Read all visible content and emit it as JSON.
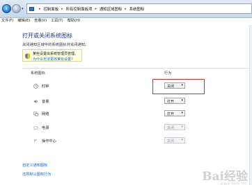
{
  "address_bar": {
    "breadcrumbs": [
      "控制面板",
      "所有控制面板项",
      "通知区域图标",
      "系统图标"
    ]
  },
  "menu": {
    "items": [
      "文件(F)",
      "编辑(E)",
      "查看(V)",
      "工具(T)",
      "帮助(H)"
    ]
  },
  "page": {
    "title": "打开或关闭系统图标",
    "subtitle": "关闭通知区域中的系统图标并关闭通知。"
  },
  "notice": {
    "text": "某些设置由系统管理员管理。",
    "link": "为什么无法更改某些设置?"
  },
  "table": {
    "col_icon": "系统图标",
    "col_behavior": "行为",
    "rows": [
      {
        "label": "时钟",
        "value": "关闭",
        "enabled": true,
        "icon": "clock-icon"
      },
      {
        "label": "音量",
        "value": "打开",
        "enabled": true,
        "icon": "volume-icon"
      },
      {
        "label": "网络",
        "value": "打开",
        "enabled": true,
        "icon": "network-icon"
      },
      {
        "label": "电源",
        "value": "关闭",
        "enabled": false,
        "icon": "power-icon"
      },
      {
        "label": "操作中心",
        "value": "关闭",
        "enabled": false,
        "icon": "action-center-icon"
      }
    ]
  },
  "footer": {
    "link1": "自定义通知图标",
    "link2": "还原默认图标行为"
  },
  "watermark": {
    "text": "Bai经验",
    "sub": "jingyan.baidu.com"
  },
  "colors": {
    "title": "#1e3287",
    "link": "#1b5fbf",
    "highlight": "#d42a2a"
  }
}
